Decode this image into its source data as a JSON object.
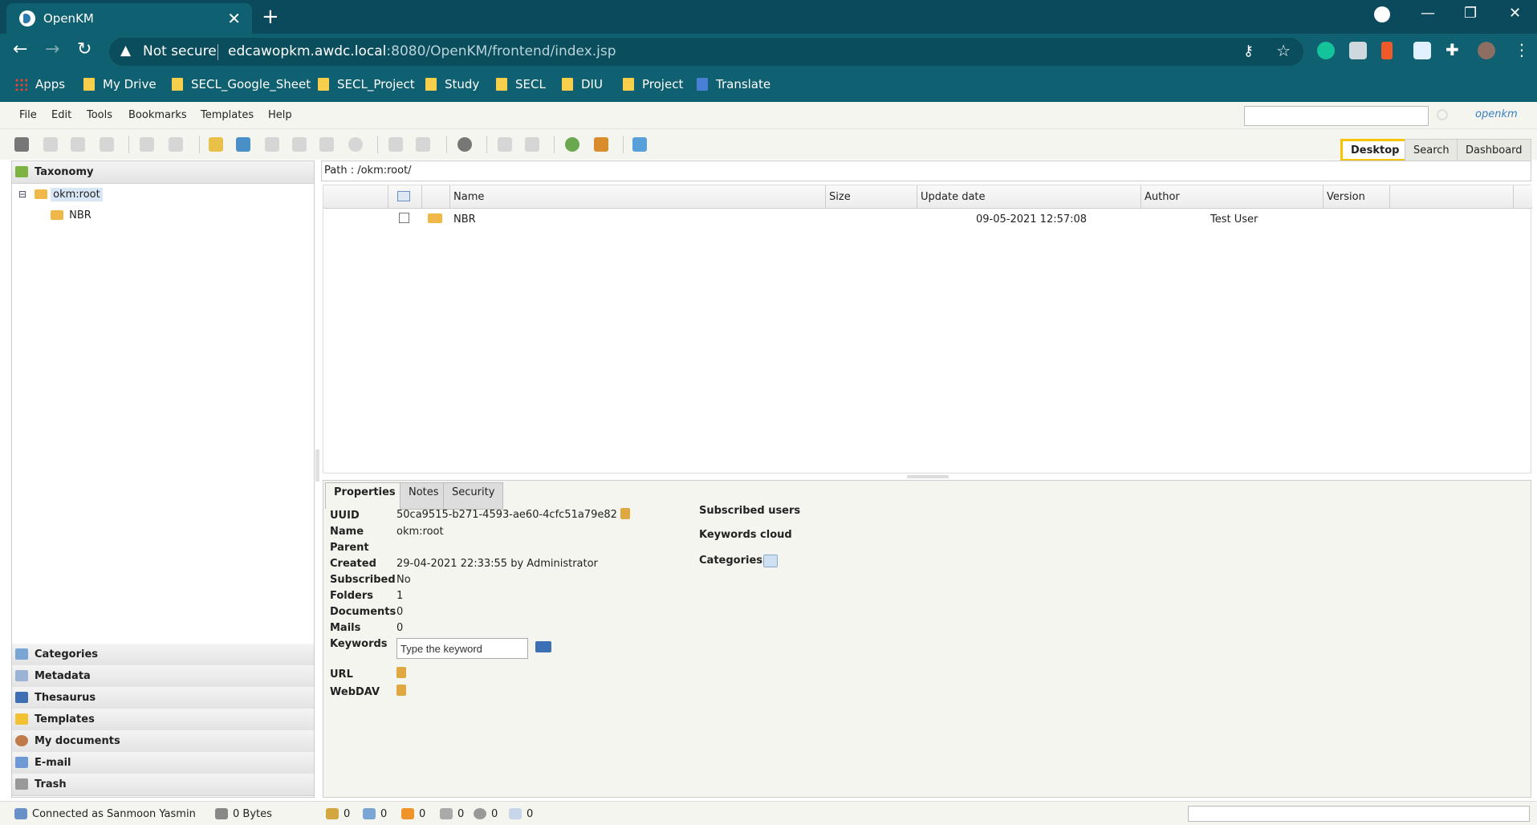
{
  "browser": {
    "tab_title": "OpenKM",
    "tab_close": "✕",
    "new_tab": "+",
    "win_minimize": "—",
    "win_restore": "❐",
    "win_close": "✕",
    "security_text": "Not secure",
    "url_host": "edcawopkm.awdc.local",
    "url_path": ":8080/OpenKM/frontend/index.jsp",
    "bookmarks": [
      "Apps",
      "My Drive",
      "SECL_Google_Sheet",
      "SECL_Project",
      "Study",
      "SECL",
      "DIU",
      "Project",
      "Translate"
    ]
  },
  "menu": [
    "File",
    "Edit",
    "Tools",
    "Bookmarks",
    "Templates",
    "Help"
  ],
  "logo_text": "openkm",
  "workspace_tabs": [
    "Desktop",
    "Search",
    "Dashboard"
  ],
  "left_panel": {
    "taxonomy": "Taxonomy",
    "tree_root": "okm:root",
    "tree_child": "NBR",
    "stack": [
      "Categories",
      "Metadata",
      "Thesaurus",
      "Templates",
      "My documents",
      "E-mail",
      "Trash"
    ]
  },
  "path_text": "Path : /okm:root/",
  "grid": {
    "headers": [
      "Name",
      "Size",
      "Update date",
      "Author",
      "Version"
    ],
    "rows": [
      {
        "name": "NBR",
        "size": "",
        "update": "09-05-2021 12:57:08",
        "author": "Test User",
        "version": ""
      }
    ]
  },
  "properties": {
    "tabs": [
      "Properties",
      "Notes",
      "Security"
    ],
    "labels": [
      "UUID",
      "Name",
      "Parent",
      "Created",
      "Subscribed",
      "Folders",
      "Documents",
      "Mails",
      "Keywords",
      "URL",
      "WebDAV"
    ],
    "values": {
      "uuid": "50ca9515-b271-4593-ae60-4cfc51a79e82",
      "name": "okm:root",
      "parent": "",
      "created": "29-04-2021 22:33:55 by Administrator",
      "subscribed": "No",
      "folders": "1",
      "documents": "0",
      "mails": "0"
    },
    "keyword_placeholder": "Type the keyword",
    "right_labels": [
      "Subscribed users",
      "Keywords cloud",
      "Categories"
    ]
  },
  "status": {
    "connected": "Connected as Sanmoon Yasmin",
    "bytes": "0 Bytes",
    "counters": [
      "0",
      "0",
      "0",
      "0",
      "0",
      "0"
    ]
  },
  "colors": {
    "chrome": "#0f6070",
    "highlight": "#f7c500",
    "accent": "#3a7fc2"
  }
}
